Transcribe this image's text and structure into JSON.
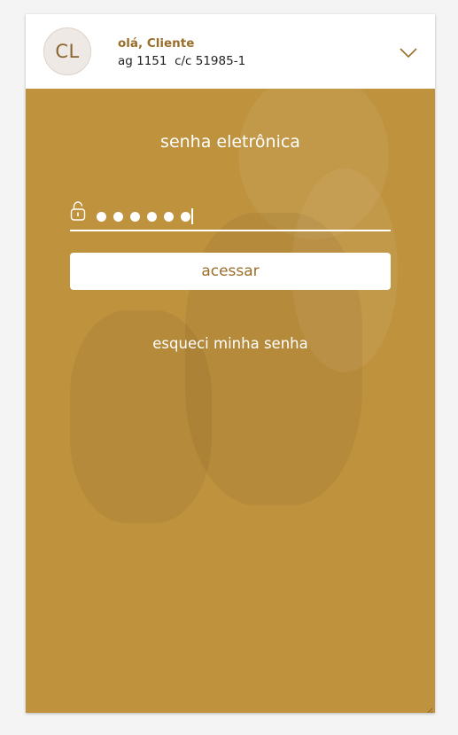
{
  "user": {
    "initials": "CL",
    "greeting": "olá, Cliente",
    "account": "ag 1151  c/c 51985-1"
  },
  "login": {
    "title": "senha eletrônica",
    "password_dots": 6,
    "submit_label": "acessar",
    "forgot_label": "esqueci minha senha"
  },
  "icons": {
    "account_toggle": "chevron-down-icon",
    "password_field": "lock-icon"
  },
  "colors": {
    "accent": "#9a6e2a",
    "panel": "#bf923e",
    "page_background": "#f4f4f4"
  }
}
